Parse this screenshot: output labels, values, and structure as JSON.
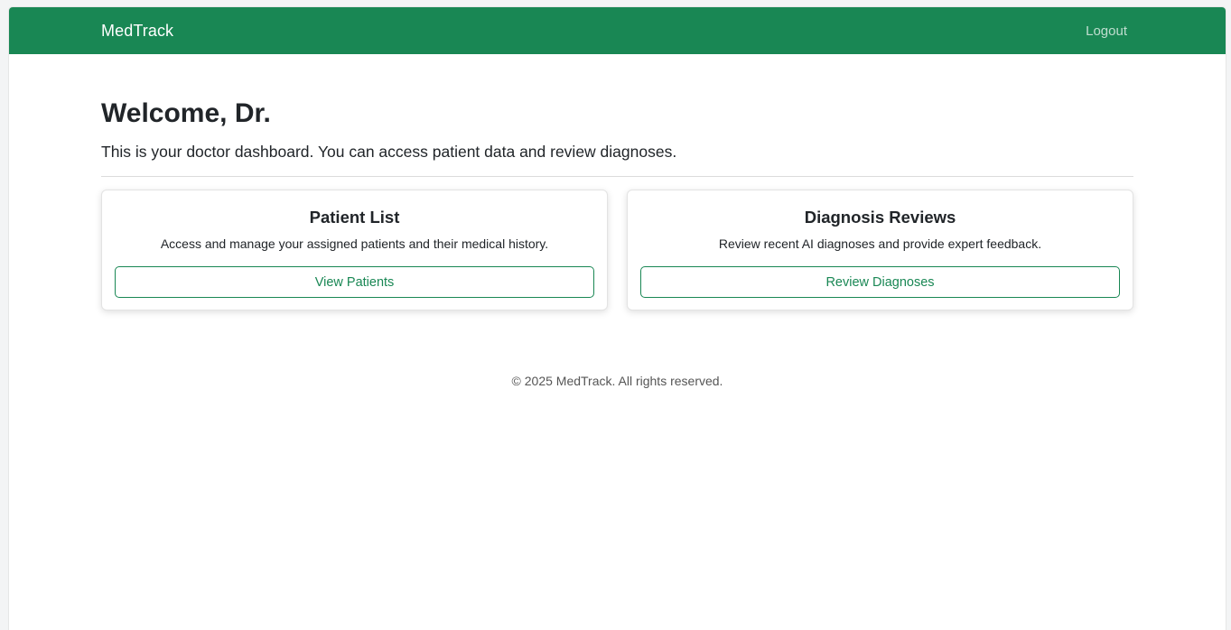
{
  "navbar": {
    "brand": "MedTrack",
    "logout_label": "Logout"
  },
  "welcome": {
    "title": "Welcome, Dr.",
    "subtitle": "This is your doctor dashboard. You can access patient data and review diagnoses."
  },
  "cards": [
    {
      "title": "Patient List",
      "text": "Access and manage your assigned patients and their medical history.",
      "button_label": "View Patients"
    },
    {
      "title": "Diagnosis Reviews",
      "text": "Review recent AI diagnoses and provide expert feedback.",
      "button_label": "Review Diagnoses"
    }
  ],
  "footer": {
    "text": "© 2025 MedTrack. All rights reserved."
  },
  "colors": {
    "brand": "#198754",
    "text": "#212529",
    "muted": "#555555"
  }
}
